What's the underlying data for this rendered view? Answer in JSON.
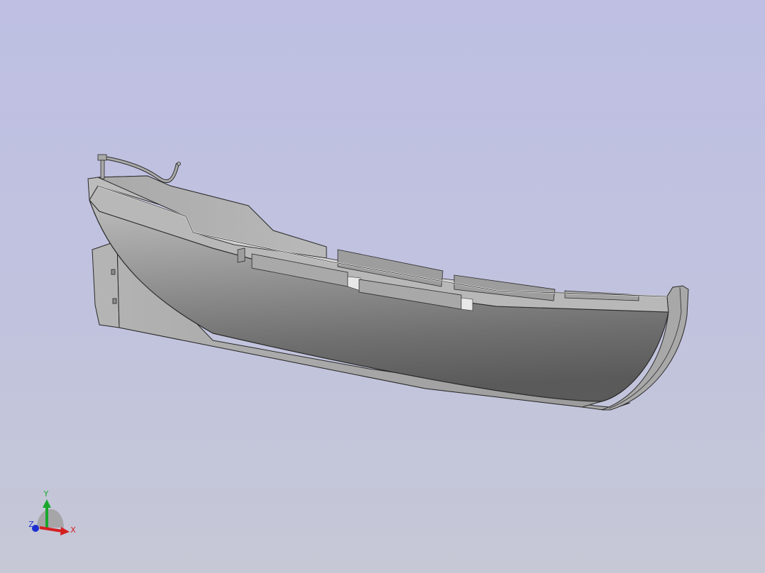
{
  "viewport": {
    "background_top": "#bebfe3",
    "background_bottom": "#c6c8d6",
    "model_color": "#8e8e8e",
    "edge_color": "#2a2a2a"
  },
  "triad": {
    "x_label": "X",
    "y_label": "Y",
    "z_label": "Z",
    "x_color": "#d42020",
    "y_color": "#19a82c",
    "z_color": "#1c2fd0"
  }
}
